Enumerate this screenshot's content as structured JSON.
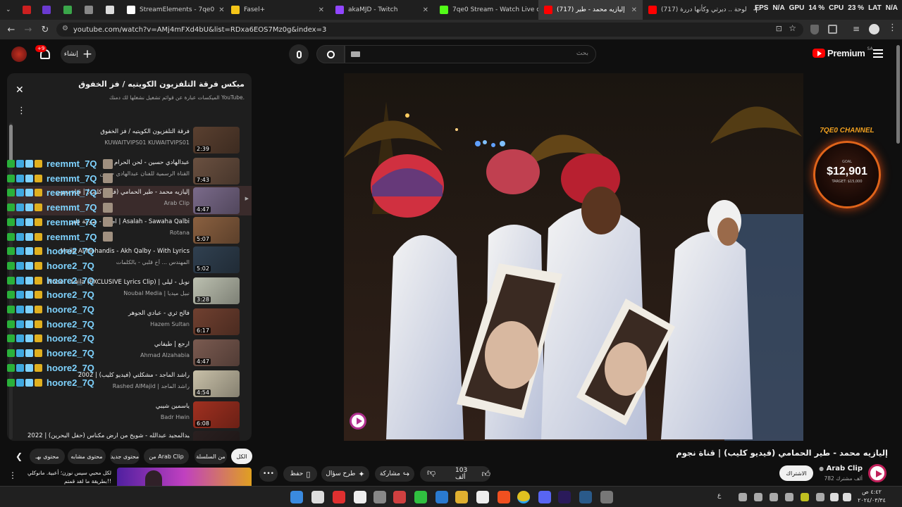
{
  "browser": {
    "tabs": [
      {
        "label": "",
        "color": "#cc2020"
      },
      {
        "label": "",
        "color": "#3aa64a"
      },
      {
        "label": "",
        "color": "#888888"
      },
      {
        "label": "",
        "color": "#dddddd"
      },
      {
        "label": "StreamElements - 7qe0",
        "color": "#ffffff"
      },
      {
        "label": "Fasel+",
        "color": "#f5c518"
      },
      {
        "label": "akaMJD - Twitch",
        "color": "#9146ff"
      },
      {
        "label": "7qe0 Stream - Watch Live on",
        "color": "#53fc18"
      },
      {
        "label": "(717) إليازيه محمد - طير",
        "color": "#ff0000"
      },
      {
        "label": "(717) لوحة .. ديرتي وكأنها دررة",
        "color": "#ff0000"
      }
    ],
    "new_tab": "+",
    "url": "youtube.com/watch?v=AMj4mFXd4bU&list=RDxa6EOS7Mz0g&index=3"
  },
  "stats": {
    "fps_label": "FPS",
    "fps_value": "N/A",
    "gpu_label": "GPU",
    "gpu_value": "14 %",
    "cpu_label": "CPU",
    "cpu_value": "23 %",
    "lat_label": "LAT",
    "lat_value": "N/A"
  },
  "header": {
    "create_label": "إنشاء",
    "notif_count": "+9",
    "search_placeholder": "بحث",
    "logo_text": "Premium",
    "region": "SA"
  },
  "playlist": {
    "title": "ميكس فرقة التلفزيون الكويتيه / فز الخفوق",
    "subtitle": "الميكسات عبارة عن قوائم تشغيل نشغلها لك دمنك YouTube.",
    "items": [
      {
        "title": "فرقة التلفزيون الكويتيه / فز الخفوق",
        "channel": "KUWAITVIPS01 KUWAITVIPS01",
        "duration": "2:39",
        "color": "#5a4030"
      },
      {
        "title": "عبدالهادي حسين - لحن الحرام",
        "channel": "القناة الرسمية للفنان عبدالهادي حسين",
        "duration": "7:43",
        "color": "#6a5040"
      },
      {
        "title": "إليازيه محمد - طير الحمامي (فيديو كليب) | قناة نجوم",
        "channel": "Arab Clip",
        "duration": "4:47",
        "color": "#7a6a8a"
      },
      {
        "title": "أصالة - صوحة قلبي | Asalah - Sawaha Qalbi",
        "channel": "Rotana",
        "duration": "5:07",
        "color": "#8a6040"
      },
      {
        "title": "Majid Al Mohandis - Akh Qalby - With Lyrics",
        "channel": "المهندس ... آخ قلبي - بالكلمات",
        "duration": "5:02",
        "color": "#304050"
      },
      {
        "title": "Nobel - Laila (EXCLUSIVE Lyrics Clip) | نوبل - ليلى",
        "channel": "Noubal Media | نبيل ميديا",
        "duration": "3:28",
        "color": "#bcc0b0"
      },
      {
        "title": "فالح ثري - عبادي الجوهر",
        "channel": "Hazem Sultan",
        "duration": "6:17",
        "color": "#704030"
      },
      {
        "title": "ارجع | طيفاني",
        "channel": "Ahmad Alzahabia",
        "duration": "4:47",
        "color": "#7a5a50"
      },
      {
        "title": "راشد الماجد - مشكلتي (فيديو كليب) | 2002",
        "channel": "Rashed AlMajid | راشد الماجد",
        "duration": "4:54",
        "color": "#c8c0a8"
      },
      {
        "title": "ياسمين شيبي",
        "channel": "Badr Hwin",
        "duration": "6:08",
        "color": "#a03020"
      },
      {
        "title": "عبدالمجيد عبدالله - شويخ من ارض مكناس (حفل البحرين) | 2022",
        "channel": "",
        "duration": "",
        "color": "#2a2020"
      }
    ]
  },
  "chat": {
    "names": [
      "reemmt_7Q",
      "reemmt_7Q",
      "reemmt_7Q",
      "reemmt_7Q",
      "reemmt_7Q",
      "reemmt_7Q",
      "hoore2_7Q",
      "hoore2_7Q",
      "hoore2_7Q",
      "hoore2_7Q",
      "hoore2_7Q",
      "hoore2_7Q",
      "hoore2_7Q",
      "hoore2_7Q",
      "hoore2_7Q",
      "hoore2_7Q"
    ]
  },
  "overlay": {
    "channel": "7QE0 CHANNEL",
    "goal_label": "GOAL",
    "goal_amount": "$12,901",
    "goal_target": "TARGET: $15,000"
  },
  "video": {
    "title": "إليازيه محمد - طير الحمامي (فيديو كليب) | قناة نجوم",
    "channel": "Arab Clip",
    "subscribers": "782 ألف مشترك",
    "subscribe_label": "الاشتراك",
    "likes": "103 ألف",
    "share": "مشاركة",
    "ask": "طرح سؤال",
    "save": "حفظ"
  },
  "chips": [
    "الكل",
    "من السلسلة",
    "من Arab Clip",
    "محتوى جديد",
    "محتوى مشابه",
    "محتوى بهـ"
  ],
  "next": {
    "text": "لكل محبي سيس نوزن؛ أعبية. مانوكلي بطريقة ما لقد قمتم!!"
  },
  "taskbar": {
    "time": "٤:٤٢ ص",
    "date": "٢٠٢٤/٠٣/٣٤",
    "lang": "ع"
  }
}
